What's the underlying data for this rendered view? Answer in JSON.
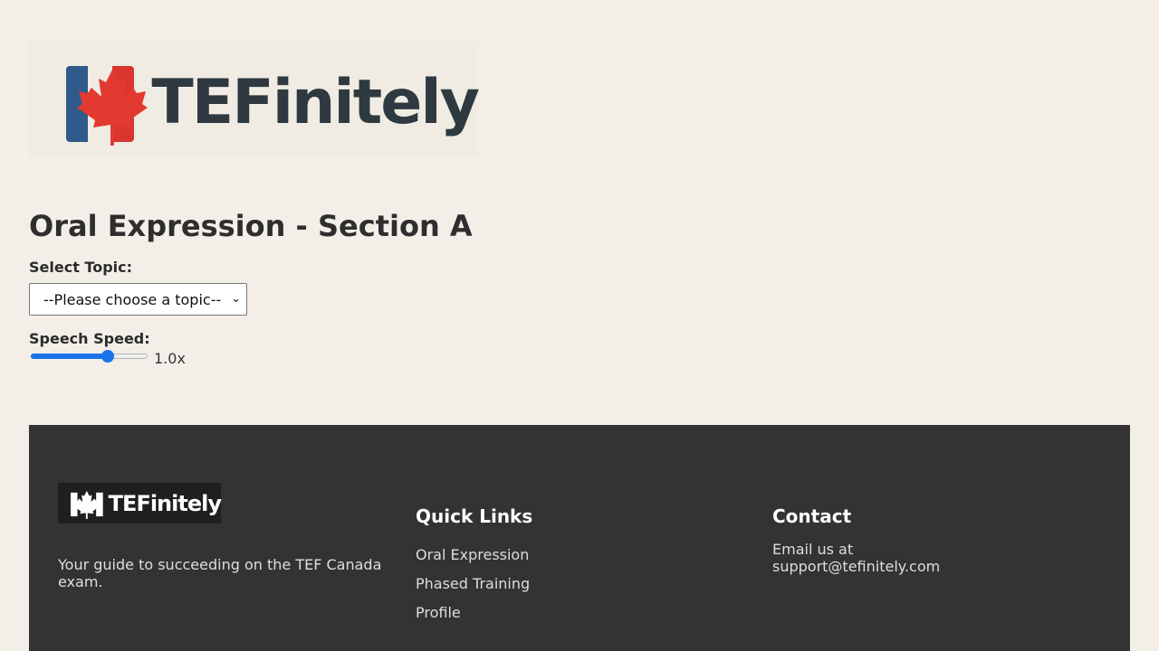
{
  "header": {
    "brand_name": "TEFinitely"
  },
  "page": {
    "title": "Oral Expression - Section A"
  },
  "topic": {
    "label": "Select Topic:",
    "selected": "--Please choose a topic--"
  },
  "speed": {
    "label": "Speech Speed:",
    "value_text": "1.0x",
    "level_fraction": 0.68
  },
  "footer": {
    "brand_name": "TEFinitely",
    "tagline": "Your guide to succeeding on the TEF Canada exam.",
    "quick_links_title": "Quick Links",
    "links": [
      "Oral Expression",
      "Phased Training",
      "Profile"
    ],
    "contact_title": "Contact",
    "contact_text": "Email us at support@tefinitely.com"
  },
  "colors": {
    "background": "#f3efe8",
    "footer_bg": "#333333",
    "accent": "#1a73e8",
    "flag_red": "#d9362f",
    "flag_blue": "#2f5a8a"
  },
  "icons": [
    "maple-leaf-icon",
    "chevron-down-icon"
  ]
}
